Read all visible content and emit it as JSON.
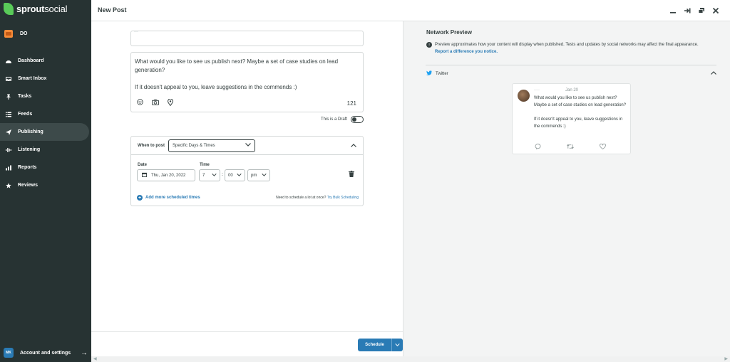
{
  "app": {
    "logo_bold": "sprout",
    "logo_regular": "social",
    "brand_initials": "DO"
  },
  "nav": {
    "items": [
      {
        "label": "Dashboard",
        "icon": "dashboard-icon"
      },
      {
        "label": "Smart Inbox",
        "icon": "inbox-icon"
      },
      {
        "label": "Tasks",
        "icon": "pin-icon"
      },
      {
        "label": "Feeds",
        "icon": "feeds-icon"
      },
      {
        "label": "Publishing",
        "icon": "paper-plane-icon",
        "active": true
      },
      {
        "label": "Listening",
        "icon": "listening-icon"
      },
      {
        "label": "Reports",
        "icon": "reports-icon"
      },
      {
        "label": "Reviews",
        "icon": "star-icon"
      }
    ],
    "account_initials": "MK",
    "account_label": "Account and settings"
  },
  "header": {
    "title": "New Post"
  },
  "editor": {
    "compose_text": "What would you like to see us publish next? Maybe a set of case studies on lead generation?\n\nIf it doesn't appeal to you, leave suggestions in the commends :)",
    "char_count": "121",
    "draft_label": "This is a Draft",
    "when_to_post_label": "When to post",
    "when_to_post_value": "Specific Days & Times",
    "date_label": "Date",
    "time_label": "Time",
    "date_value": "Thu, Jan 20, 2022",
    "hour_value": "7",
    "minute_value": "00",
    "ampm_value": "pm",
    "add_times_label": "Add more scheduled times",
    "bulk_text": "Need to schedule a lot at once?",
    "bulk_link": "Try Bulk Scheduling",
    "schedule_button": "Schedule"
  },
  "preview": {
    "title": "Network Preview",
    "info_text": "Preview approximates how your content will display when published. Tests and updates by social networks may affect the final appearance.",
    "info_link": "Report a difference you notice.",
    "network_label": "Twitter",
    "tweet_date": "Jan 20",
    "tweet_text": "What would you like to see us publish next? Maybe a set of case studies on lead generation?\n\nIf it doesn't appeal to you, leave suggestions in the commends :)"
  },
  "colors": {
    "sidebar_bg": "#273333",
    "accent": "#2a7bb5",
    "brand_green": "#59cb59",
    "twitter_blue": "#1da1f2"
  }
}
